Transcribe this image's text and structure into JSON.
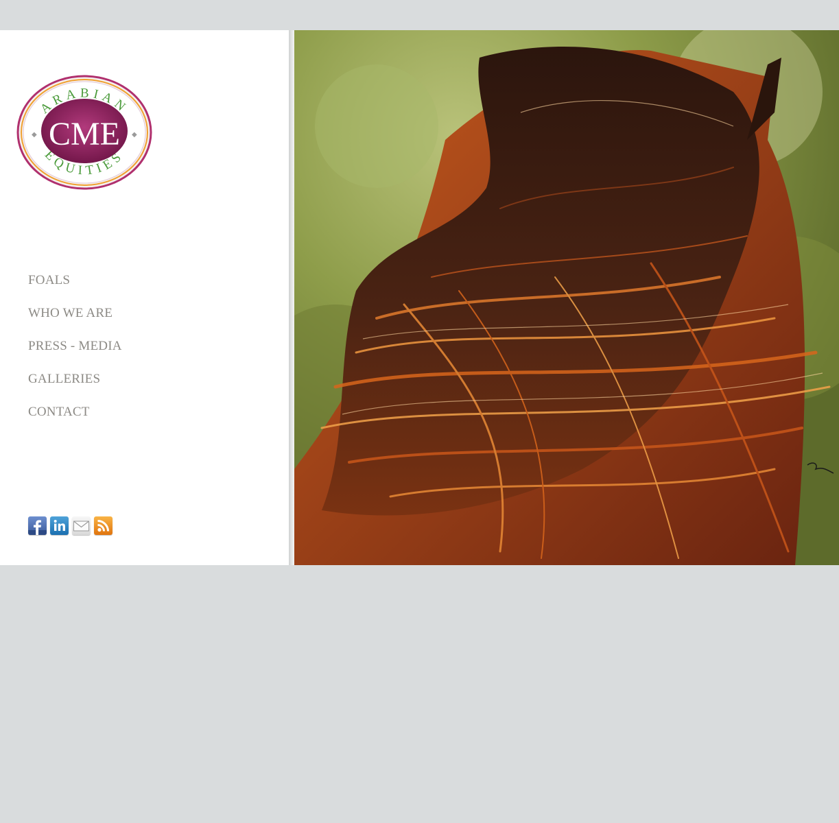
{
  "logo": {
    "top_text": "ARABIAN",
    "center_text": "CME",
    "bottom_text": "EQUITIES"
  },
  "nav": {
    "items": [
      {
        "label": "FOALS"
      },
      {
        "label": "WHO WE ARE"
      },
      {
        "label": "PRESS - MEDIA"
      },
      {
        "label": "GALLERIES"
      },
      {
        "label": "CONTACT"
      }
    ]
  },
  "social": {
    "icons": [
      "facebook-icon",
      "linkedin-icon",
      "mail-icon",
      "rss-icon"
    ]
  },
  "colors": {
    "page_bg": "#d9dcdd",
    "sidebar_bg": "#ffffff",
    "nav_text": "#8c8a85",
    "logo_purple": "#8a1f5a",
    "logo_green": "#4a9a3a",
    "logo_orange": "#f0a030"
  }
}
